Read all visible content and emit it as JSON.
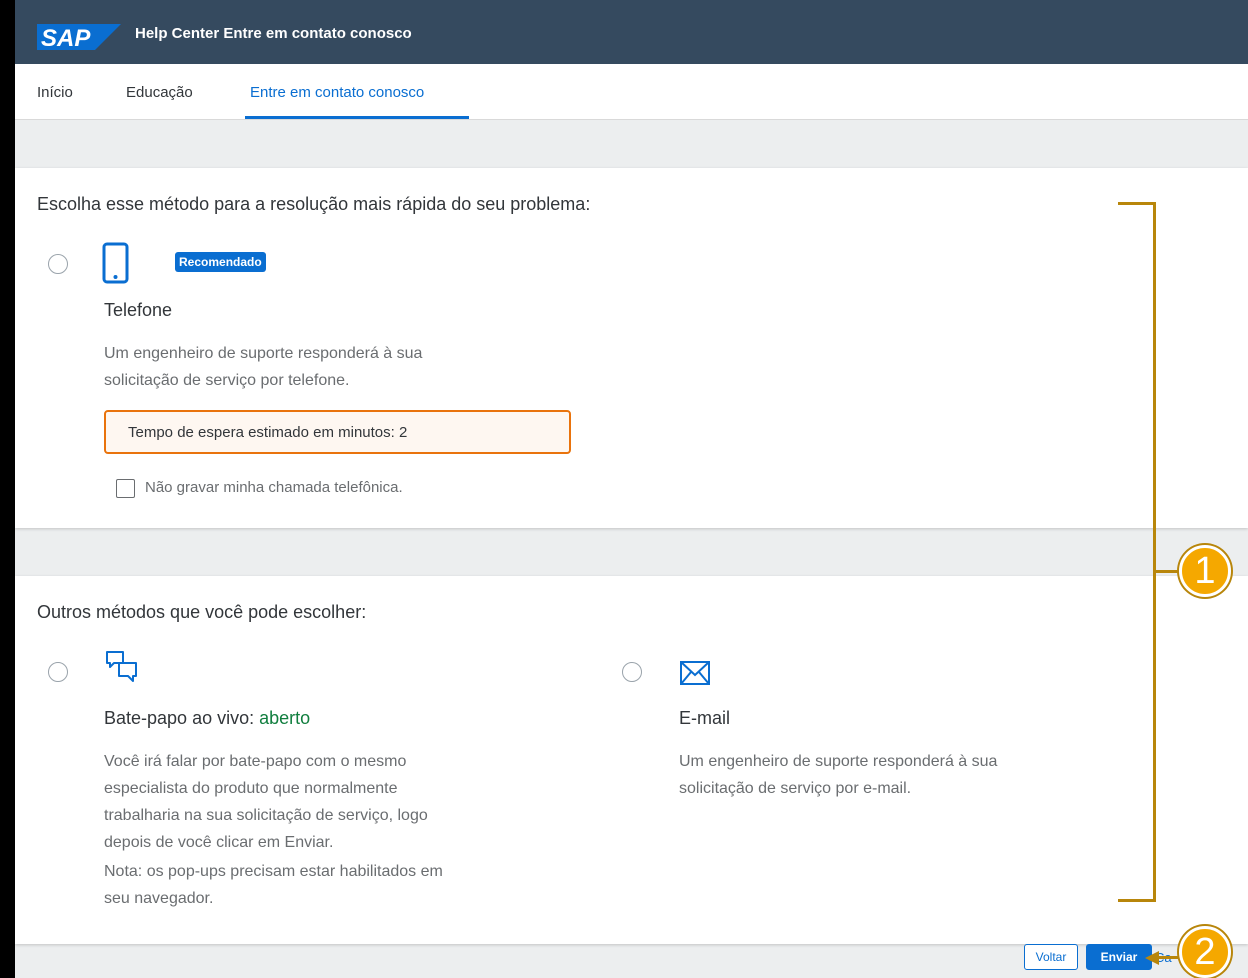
{
  "shell": {
    "logo_text": "SAP",
    "title": "Help Center Entre em contato conosco"
  },
  "tabs": [
    {
      "label": "Início"
    },
    {
      "label": "Educação"
    },
    {
      "label": "Entre em contato conosco"
    }
  ],
  "primary_section": {
    "heading": "Escolha esse método para a resolução mais rápida do seu problema:",
    "phone": {
      "icon": "smartphone-icon",
      "badge": "Recomendado",
      "title": "Telefone",
      "desc_line1": "Um engenheiro de suporte responderá à sua",
      "desc_line2": "solicitação de serviço por telefone.",
      "wait_label": "Tempo de espera estimado em minutos: 2",
      "record_opt_out": "Não gravar minha chamada telefônica."
    }
  },
  "other_section": {
    "heading": "Outros métodos que você pode escolher:",
    "chat": {
      "icon": "chat-bubbles-icon",
      "title": "Bate-papo ao vivo:",
      "status": "aberto",
      "desc_lines": [
        "Você irá falar por bate-papo com o mesmo",
        "especialista do produto que normalmente",
        "trabalharia na sua solicitação de serviço, logo",
        "depois de você clicar em Enviar."
      ],
      "note_lines": [
        "Nota: os pop-ups precisam estar habilitados em",
        "seu navegador."
      ]
    },
    "email": {
      "icon": "envelope-icon",
      "title": "E-mail",
      "desc_line1": "Um engenheiro de suporte responderá à sua",
      "desc_line2": "solicitação de serviço por e-mail."
    }
  },
  "footer": {
    "back_label": "Voltar",
    "send_label": "Enviar",
    "cancel_partial": "Ca"
  },
  "annotations": {
    "marker1": "1",
    "marker2": "2"
  },
  "colors": {
    "shell": "#354a5f",
    "accent": "#0a6ed1",
    "warning": "#e9730c",
    "success": "#107e3e",
    "annotation": "#f5a800"
  }
}
